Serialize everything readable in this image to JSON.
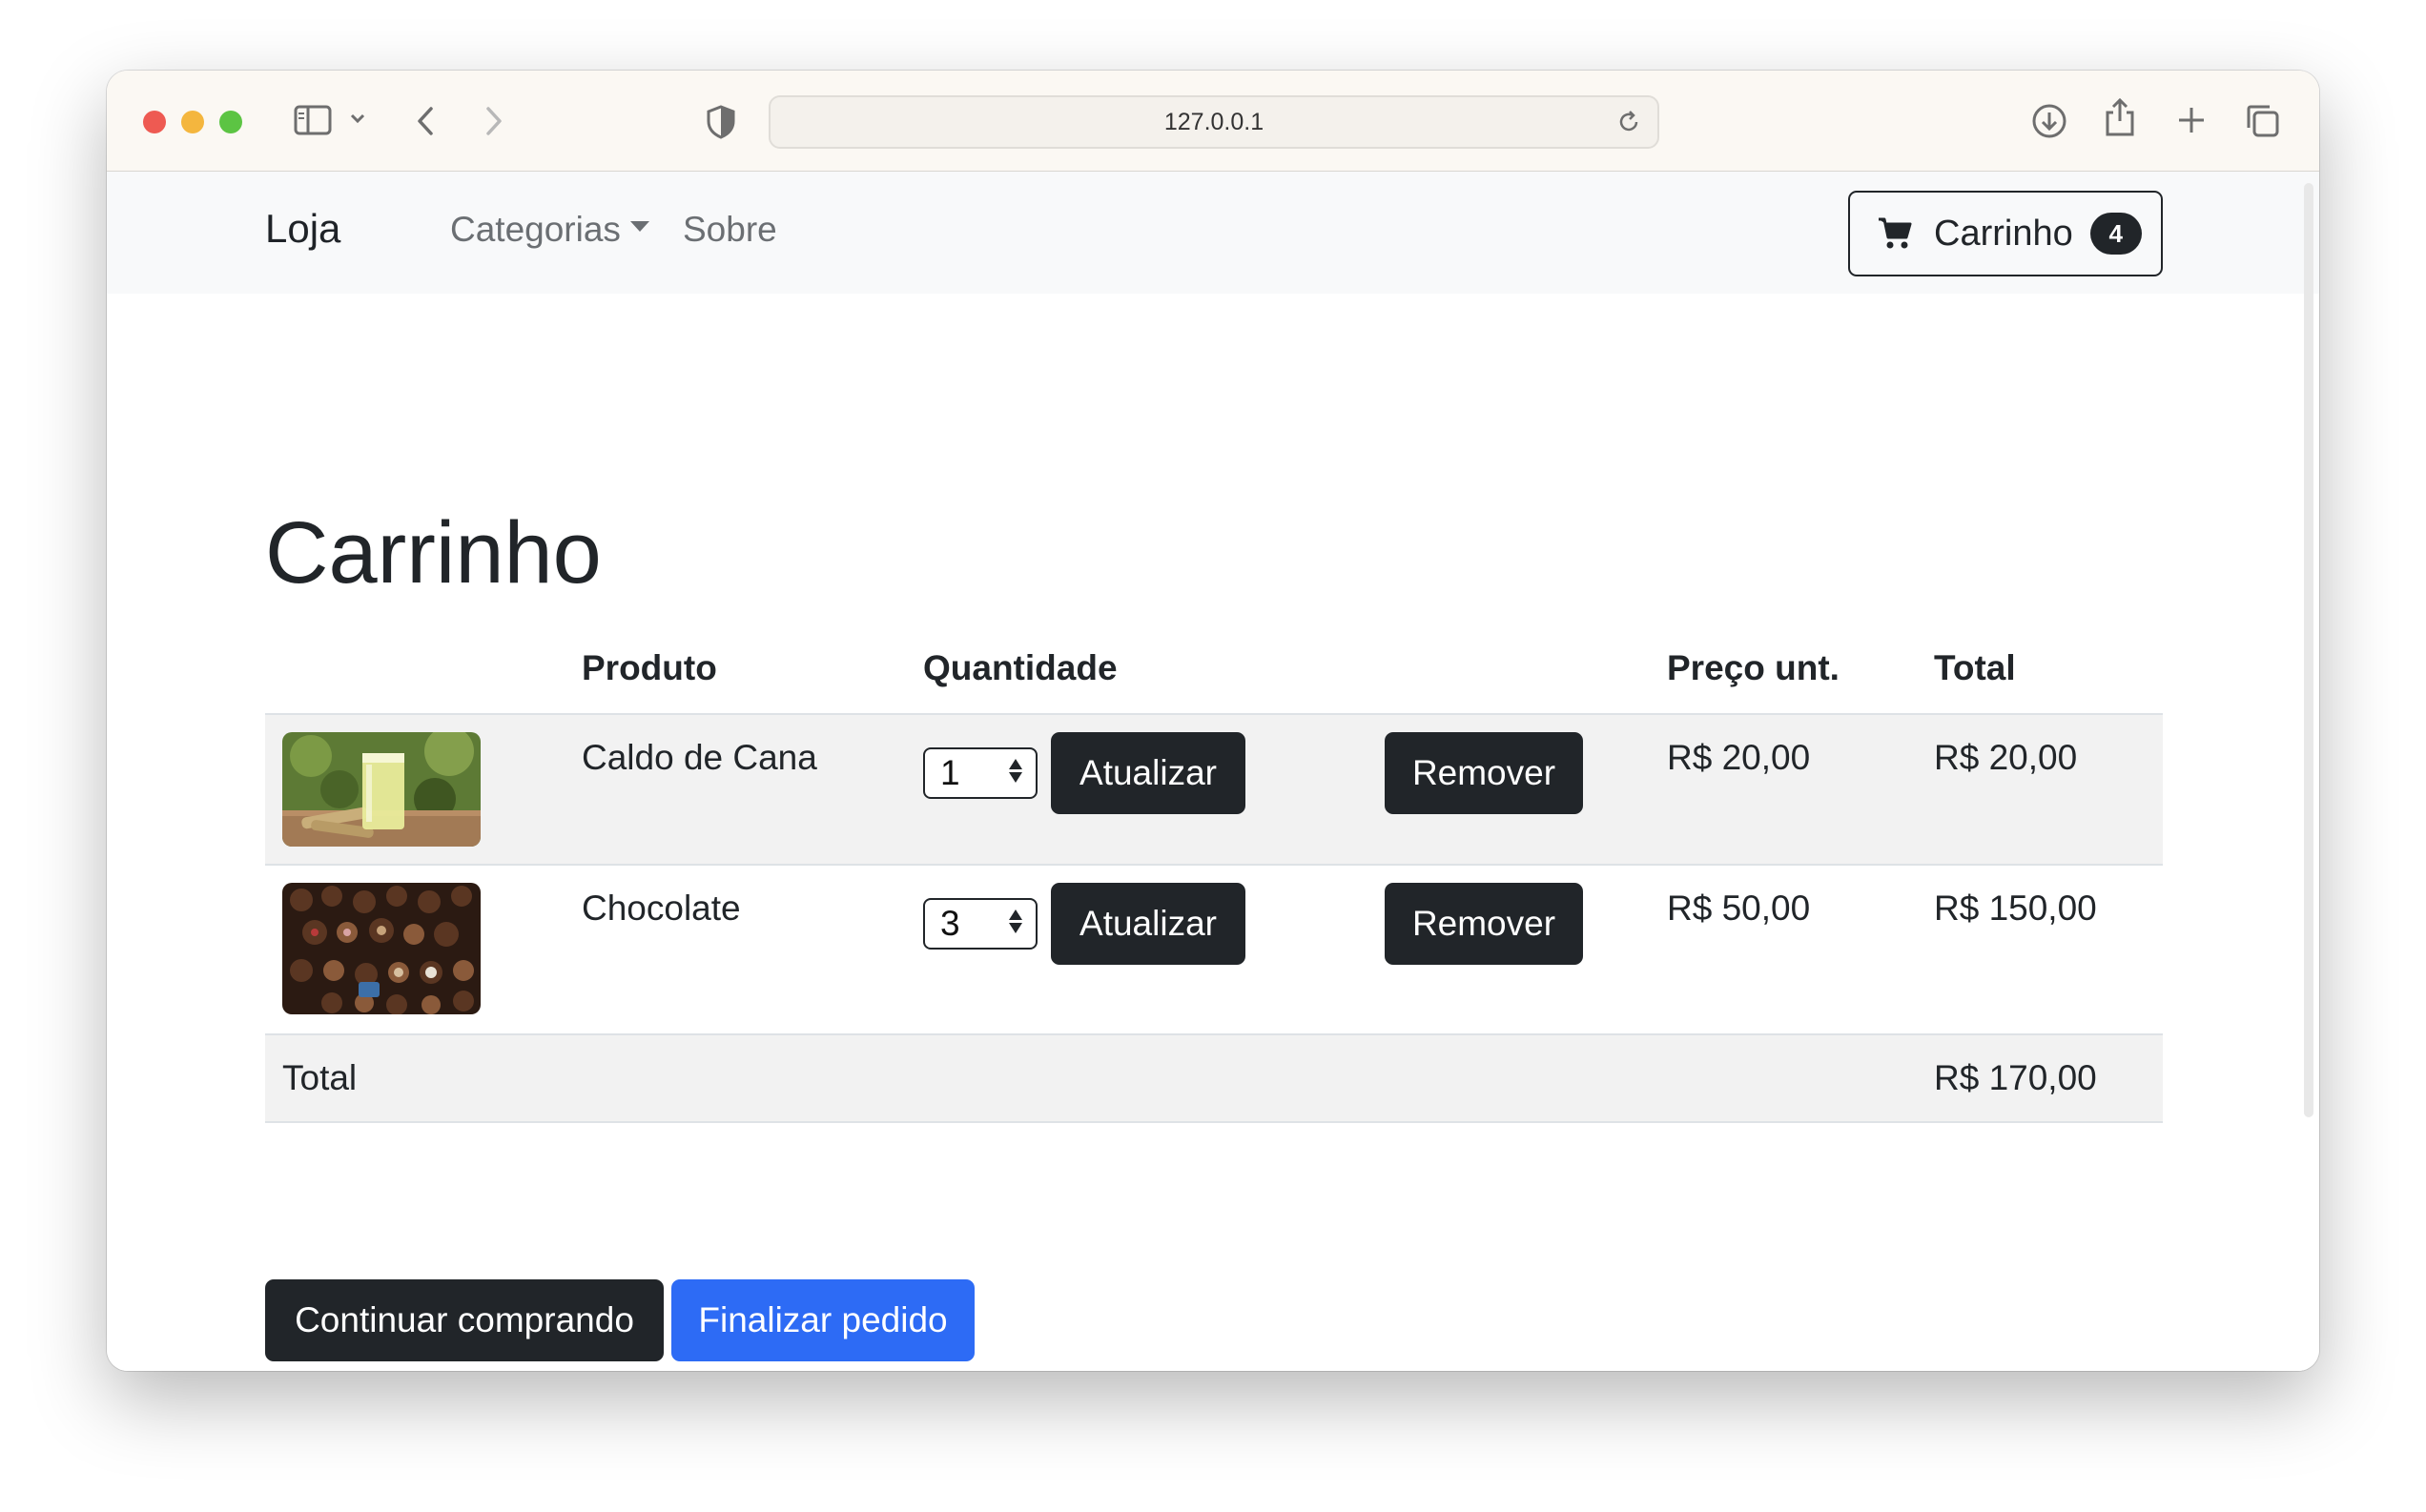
{
  "browser": {
    "url": "127.0.0.1"
  },
  "navbar": {
    "brand": "Loja",
    "links": [
      "Categorias",
      "Sobre"
    ],
    "cart_label": "Carrinho",
    "cart_count": "4"
  },
  "page": {
    "title": "Carrinho"
  },
  "table": {
    "headers": [
      "",
      "Produto",
      "Quantidade",
      "",
      "Preço unt.",
      "Total"
    ],
    "rows": [
      {
        "image": "sugarcane-juice-photo",
        "product": "Caldo de Cana",
        "quantity": "1",
        "update_label": "Atualizar",
        "remove_label": "Remover",
        "unit_price": "R$ 20,00",
        "total": "R$ 20,00"
      },
      {
        "image": "chocolates-photo",
        "product": "Chocolate",
        "quantity": "3",
        "update_label": "Atualizar",
        "remove_label": "Remover",
        "unit_price": "R$ 50,00",
        "total": "R$ 150,00"
      }
    ],
    "footer": {
      "label": "Total",
      "total": "R$ 170,00"
    }
  },
  "actions": {
    "continue_label": "Continuar comprando",
    "checkout_label": "Finalizar pedido"
  },
  "colors": {
    "dark": "#212529",
    "primary": "#2d6bf5",
    "navbar_bg": "#f8f9fa",
    "stripe": "#f2f2f2"
  }
}
